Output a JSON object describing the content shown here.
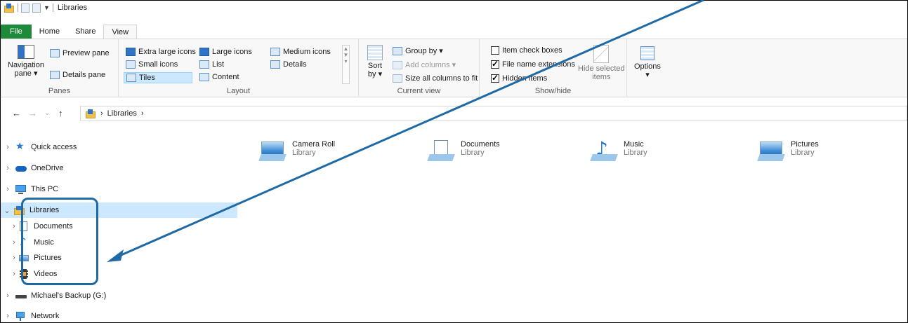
{
  "window": {
    "title": "Libraries"
  },
  "tabs": [
    {
      "label": "File"
    },
    {
      "label": "Home"
    },
    {
      "label": "Share"
    },
    {
      "label": "View"
    }
  ],
  "ribbon": {
    "panes": {
      "label": "Panes",
      "navigation_pane": "Navigation pane",
      "navigation_pane_l1": "Navigation",
      "navigation_pane_l2": "pane ▾",
      "preview_pane": "Preview pane",
      "details_pane": "Details pane"
    },
    "layout": {
      "label": "Layout",
      "extra_large_icons": "Extra large icons",
      "large_icons": "Large icons",
      "medium_icons": "Medium icons",
      "small_icons": "Small icons",
      "list": "List",
      "details": "Details",
      "tiles": "Tiles",
      "content": "Content"
    },
    "current_view": {
      "label": "Current view",
      "sort_l1": "Sort",
      "sort_l2": "by ▾",
      "group_by": "Group by ▾",
      "add_columns": "Add columns ▾",
      "size_all_columns": "Size all columns to fit"
    },
    "show_hide": {
      "label": "Show/hide",
      "item_check_boxes": "Item check boxes",
      "file_name_extensions": "File name extensions",
      "hidden_items": "Hidden items",
      "hide_selected_l1": "Hide selected",
      "hide_selected_l2": "items"
    },
    "options": {
      "label": "Options",
      "arrow": "▾"
    }
  },
  "address": {
    "crumb_sep": "›",
    "crumb": "Libraries",
    "crumb_tail": "›"
  },
  "nav": {
    "items": [
      {
        "label": "Quick access"
      },
      {
        "label": "OneDrive"
      },
      {
        "label": "This PC"
      },
      {
        "label": "Libraries"
      },
      {
        "label": "Documents"
      },
      {
        "label": "Music"
      },
      {
        "label": "Pictures"
      },
      {
        "label": "Videos"
      },
      {
        "label": "Michael's Backup (G:)"
      },
      {
        "label": "Network"
      }
    ]
  },
  "content": {
    "tiles": [
      {
        "name": "Camera Roll",
        "type": "Library"
      },
      {
        "name": "Documents",
        "type": "Library"
      },
      {
        "name": "Music",
        "type": "Library"
      },
      {
        "name": "Pictures",
        "type": "Library"
      }
    ]
  },
  "colors": {
    "file_tab": "#1d8a3a",
    "selection": "#cce8ff",
    "annotation": "#1f6aa5"
  }
}
